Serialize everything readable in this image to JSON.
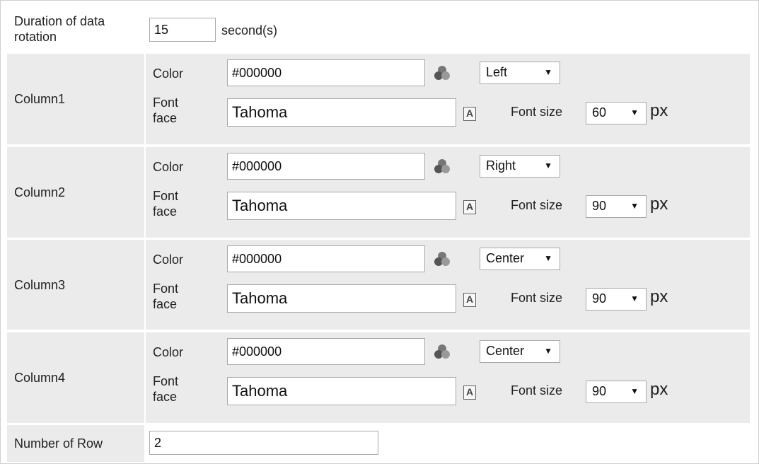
{
  "duration": {
    "label": "Duration of data rotation",
    "value": "15",
    "unit": "second(s)"
  },
  "column_common": {
    "color_label": "Color",
    "font_face_label": "Font face",
    "font_size_label": "Font size",
    "px_label": "px",
    "color_picker_icon": "color-palette-icon",
    "font_picker_icon": "font-picker-icon"
  },
  "columns": [
    {
      "name": "Column1",
      "color": "#000000",
      "align": "Left",
      "font_face": "Tahoma",
      "font_size": "60"
    },
    {
      "name": "Column2",
      "color": "#000000",
      "align": "Right",
      "font_face": "Tahoma",
      "font_size": "90"
    },
    {
      "name": "Column3",
      "color": "#000000",
      "align": "Center",
      "font_face": "Tahoma",
      "font_size": "90"
    },
    {
      "name": "Column4",
      "color": "#000000",
      "align": "Center",
      "font_face": "Tahoma",
      "font_size": "90"
    }
  ],
  "rows": {
    "label": "Number of Row",
    "value": "2"
  },
  "colors": {
    "row_shade": "#ebebeb",
    "border": "#a9a9a9"
  }
}
